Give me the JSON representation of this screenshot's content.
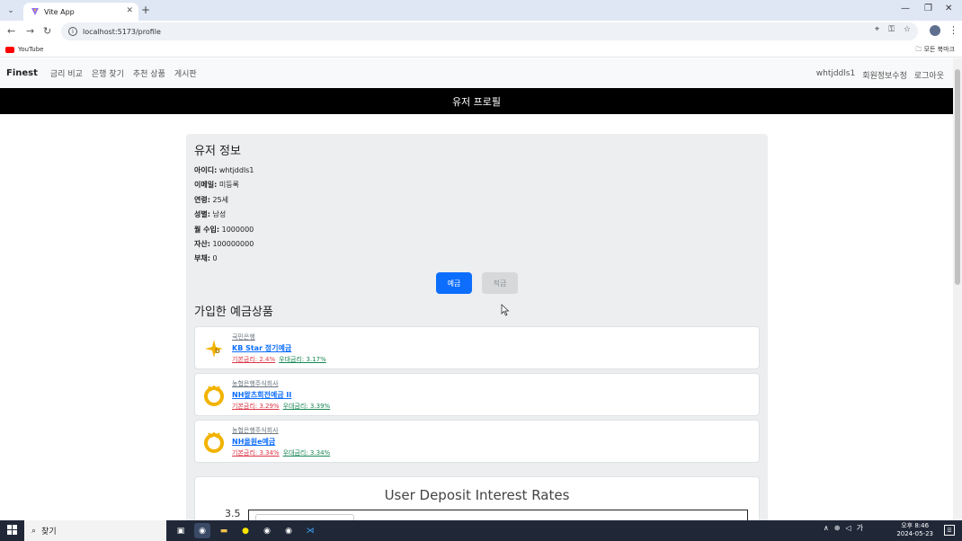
{
  "browser": {
    "tab_title": "Vite App",
    "url": "localhost:5173/profile",
    "bookmark_youtube": "YouTube",
    "all_bookmarks": "모든 북마크"
  },
  "nav": {
    "brand": "Finest",
    "links": [
      "금리 비교",
      "은행 찾기",
      "추천 상품",
      "게시판"
    ],
    "user": "whtjddls1",
    "edit_profile": "회원정보수정",
    "logout": "로그아웃"
  },
  "page_title": "유저 프로필",
  "user_info": {
    "heading": "유저 정보",
    "fields": [
      {
        "label": "아이디:",
        "value": "whtjddls1"
      },
      {
        "label": "이메일:",
        "value": "미등록"
      },
      {
        "label": "연령:",
        "value": "25세"
      },
      {
        "label": "성별:",
        "value": "남성"
      },
      {
        "label": "월 수입:",
        "value": "1000000"
      },
      {
        "label": "자산:",
        "value": "100000000"
      },
      {
        "label": "부채:",
        "value": "0"
      }
    ]
  },
  "buttons": {
    "deposit": "예금",
    "savings": "적금"
  },
  "products_heading": "가입한 예금상품",
  "products": [
    {
      "bank": "국민은행",
      "name": "KB Star 정기예금",
      "base": "기본금리: 2.4%",
      "pref": "우대금리: 3.17%",
      "logo": "kb-logo"
    },
    {
      "bank": "농협은행주식회사",
      "name": "NH왈츠회전예금 II",
      "base": "기본금리: 3.29%",
      "pref": "우대금리: 3.39%",
      "logo": "nh-logo"
    },
    {
      "bank": "농협은행주식회사",
      "name": "NH올원e예금",
      "base": "기본금리: 3.34%",
      "pref": "우대금리: 3.34%",
      "logo": "nh-logo"
    }
  ],
  "chart": {
    "title": "User Deposit Interest Rates",
    "visible_ytick": "3.5"
  },
  "taskbar": {
    "search_placeholder": "찾기",
    "time": "오후 8:46",
    "date": "2024-05-23"
  },
  "colors": {
    "primary": "#0d6efd",
    "base_rate": "#dc3545",
    "pref_rate": "#198754",
    "title_bar": "#000000"
  }
}
